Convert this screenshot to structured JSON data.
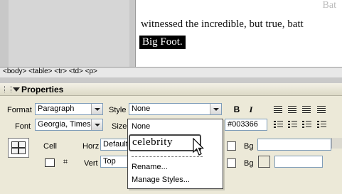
{
  "document": {
    "corner_text": "Bat",
    "line1": "witnessed the incredible, but true, batt",
    "selected_text": "Big Foot."
  },
  "tag_selector": "<body> <table> <tr> <td> <p>",
  "properties": {
    "title": "Properties",
    "format_label": "Format",
    "format_value": "Paragraph",
    "style_label": "Style",
    "style_value": "None",
    "bold": "B",
    "italic": "I",
    "font_label": "Font",
    "font_value": "Georgia, Times",
    "size_label": "Size",
    "color_value": "#003366",
    "cell_label": "Cell",
    "horz_label": "Horz",
    "horz_value": "Default",
    "vert_label": "Vert",
    "vert_value": "Top",
    "bg_label_1": "Bg",
    "bg_label_2": "Bg"
  },
  "style_menu": {
    "items": [
      "None",
      "celebrity",
      "Rename...",
      "Manage Styles..."
    ],
    "highlighted": "celebrity"
  },
  "colors": {
    "panel_bg": "#ece9d8",
    "selection_bg": "#000000",
    "field_border": "#7f9db9"
  }
}
